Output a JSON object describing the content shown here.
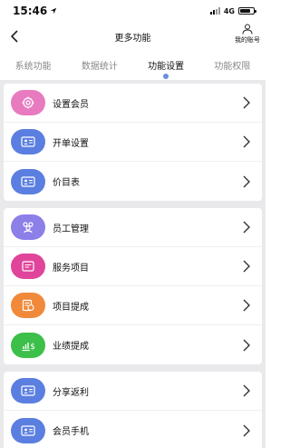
{
  "status_bar": {
    "time": "15:46",
    "network": "4G"
  },
  "nav": {
    "title": "更多功能",
    "account_label": "我的账号"
  },
  "tabs": [
    {
      "label": "系统功能",
      "active": false
    },
    {
      "label": "数据统计",
      "active": false
    },
    {
      "label": "功能设置",
      "active": true
    },
    {
      "label": "功能权限",
      "active": false
    }
  ],
  "groups": [
    {
      "items": [
        {
          "label": "设置会员",
          "icon": "gear-icon",
          "color": "#e87ac0"
        },
        {
          "label": "开单设置",
          "icon": "id-card-icon",
          "color": "#5b7fe0"
        },
        {
          "label": "价目表",
          "icon": "id-card-icon",
          "color": "#5b7fe0"
        }
      ]
    },
    {
      "items": [
        {
          "label": "员工管理",
          "icon": "staff-icon",
          "color": "#8d7fe8"
        },
        {
          "label": "服务项目",
          "icon": "card-icon",
          "color": "#e0459b"
        },
        {
          "label": "项目提成",
          "icon": "coin-icon",
          "color": "#f08a3a"
        },
        {
          "label": "业绩提成",
          "icon": "chart-dollar-icon",
          "color": "#3cc04a"
        }
      ]
    },
    {
      "items": [
        {
          "label": "分享返利",
          "icon": "id-card-icon",
          "color": "#5b7fe0"
        },
        {
          "label": "会员手机",
          "icon": "id-card-icon",
          "color": "#5b7fe0"
        }
      ]
    }
  ]
}
